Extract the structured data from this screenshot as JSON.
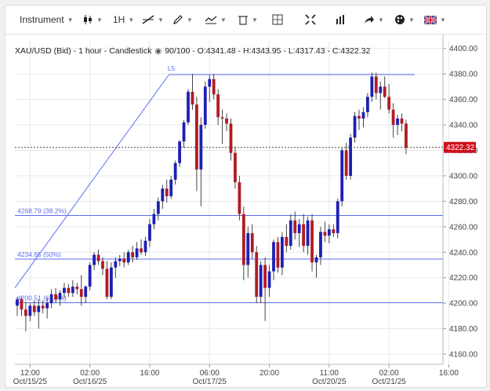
{
  "toolbar": {
    "instrument_label": "Instrument",
    "timeframe_label": "1H",
    "icons": [
      "candlestick-icon",
      "line-tool-icon",
      "pencil-icon",
      "compare-icon",
      "trash-icon",
      "crosshair-icon",
      "fullscreen-icon",
      "volume-bars-icon",
      "share-arrow-icon",
      "palette-icon",
      "flag-uk-icon"
    ]
  },
  "legend": {
    "symbol": "XAU/USD (Bid) - 1 hour - Candlestick",
    "quality": "90/100",
    "ohlc": "- O:4341.48 - H:4343.95 - L:4317.43 - C:4322.32"
  },
  "colors": {
    "up": "#1f1fb4",
    "down": "#b01c24",
    "line": "#5b6ef0",
    "last_price": "#d0101c"
  },
  "chart_data": {
    "type": "candlestick",
    "y_ticks": [
      "4400.00",
      "4380.00",
      "4360.00",
      "4340.00",
      "4320.00",
      "4300.00",
      "4280.00",
      "4260.00",
      "4240.00",
      "4220.00",
      "4200.00",
      "4180.00",
      "4160.00"
    ],
    "ylim": [
      4152,
      4406
    ],
    "x_ticks": [
      {
        "time": "12:00",
        "date": "Oct/15/25",
        "i": 3
      },
      {
        "time": "02:00",
        "date": "Oct/16/25",
        "i": 17
      },
      {
        "time": "16:00",
        "date": "",
        "i": 31
      },
      {
        "time": "06:00",
        "date": "Oct/17/25",
        "i": 45
      },
      {
        "time": "20:00",
        "date": "",
        "i": 59
      },
      {
        "time": "11:00",
        "date": "Oct/20/25",
        "i": 73
      },
      {
        "time": "02:00",
        "date": "Oct/21/25",
        "i": 87
      },
      {
        "time": "16:00",
        "date": "",
        "i": 101
      }
    ],
    "last_price": 4322.32,
    "last_price_label": "4322.32",
    "fib_levels": [
      {
        "label": "4268.79 (38.2%)",
        "value": 4268.79
      },
      {
        "label": "4234.65 (50%)",
        "value": 4234.65
      },
      {
        "label": "4200.51 (61.8%)",
        "value": 4200.51
      }
    ],
    "top_line": {
      "label": "L5",
      "value": 4379.5
    },
    "candles": [
      {
        "o": 4198,
        "h": 4205,
        "l": 4190,
        "c": 4203
      },
      {
        "o": 4203,
        "h": 4205,
        "l": 4190,
        "c": 4195
      },
      {
        "o": 4195,
        "h": 4201,
        "l": 4178,
        "c": 4190
      },
      {
        "o": 4190,
        "h": 4200,
        "l": 4186,
        "c": 4198
      },
      {
        "o": 4198,
        "h": 4202,
        "l": 4190,
        "c": 4193
      },
      {
        "o": 4193,
        "h": 4203,
        "l": 4180,
        "c": 4198
      },
      {
        "o": 4198,
        "h": 4202,
        "l": 4192,
        "c": 4196
      },
      {
        "o": 4196,
        "h": 4204,
        "l": 4188,
        "c": 4200
      },
      {
        "o": 4200,
        "h": 4211,
        "l": 4196,
        "c": 4207
      },
      {
        "o": 4207,
        "h": 4212,
        "l": 4200,
        "c": 4203
      },
      {
        "o": 4203,
        "h": 4210,
        "l": 4198,
        "c": 4208
      },
      {
        "o": 4208,
        "h": 4216,
        "l": 4204,
        "c": 4212
      },
      {
        "o": 4212,
        "h": 4215,
        "l": 4205,
        "c": 4208
      },
      {
        "o": 4208,
        "h": 4218,
        "l": 4205,
        "c": 4213
      },
      {
        "o": 4213,
        "h": 4216,
        "l": 4207,
        "c": 4211
      },
      {
        "o": 4211,
        "h": 4222,
        "l": 4198,
        "c": 4205
      },
      {
        "o": 4205,
        "h": 4214,
        "l": 4200,
        "c": 4213
      },
      {
        "o": 4213,
        "h": 4232,
        "l": 4210,
        "c": 4230
      },
      {
        "o": 4230,
        "h": 4240,
        "l": 4226,
        "c": 4238
      },
      {
        "o": 4238,
        "h": 4242,
        "l": 4230,
        "c": 4233
      },
      {
        "o": 4233,
        "h": 4236,
        "l": 4222,
        "c": 4227
      },
      {
        "o": 4227,
        "h": 4233,
        "l": 4203,
        "c": 4205
      },
      {
        "o": 4205,
        "h": 4232,
        "l": 4203,
        "c": 4228
      },
      {
        "o": 4228,
        "h": 4236,
        "l": 4220,
        "c": 4233
      },
      {
        "o": 4233,
        "h": 4238,
        "l": 4229,
        "c": 4235
      },
      {
        "o": 4235,
        "h": 4240,
        "l": 4228,
        "c": 4232
      },
      {
        "o": 4232,
        "h": 4242,
        "l": 4230,
        "c": 4240
      },
      {
        "o": 4240,
        "h": 4245,
        "l": 4232,
        "c": 4236
      },
      {
        "o": 4236,
        "h": 4248,
        "l": 4234,
        "c": 4243
      },
      {
        "o": 4243,
        "h": 4250,
        "l": 4238,
        "c": 4240
      },
      {
        "o": 4240,
        "h": 4252,
        "l": 4237,
        "c": 4249
      },
      {
        "o": 4249,
        "h": 4266,
        "l": 4244,
        "c": 4262
      },
      {
        "o": 4262,
        "h": 4274,
        "l": 4258,
        "c": 4270
      },
      {
        "o": 4270,
        "h": 4283,
        "l": 4265,
        "c": 4280
      },
      {
        "o": 4280,
        "h": 4293,
        "l": 4274,
        "c": 4290
      },
      {
        "o": 4290,
        "h": 4297,
        "l": 4279,
        "c": 4284
      },
      {
        "o": 4284,
        "h": 4300,
        "l": 4282,
        "c": 4297
      },
      {
        "o": 4297,
        "h": 4312,
        "l": 4293,
        "c": 4310
      },
      {
        "o": 4310,
        "h": 4328,
        "l": 4307,
        "c": 4327
      },
      {
        "o": 4327,
        "h": 4344,
        "l": 4322,
        "c": 4342
      },
      {
        "o": 4342,
        "h": 4368,
        "l": 4340,
        "c": 4366
      },
      {
        "o": 4366,
        "h": 4380,
        "l": 4352,
        "c": 4356
      },
      {
        "o": 4356,
        "h": 4362,
        "l": 4288,
        "c": 4305
      },
      {
        "o": 4305,
        "h": 4346,
        "l": 4276,
        "c": 4340
      },
      {
        "o": 4340,
        "h": 4374,
        "l": 4337,
        "c": 4370
      },
      {
        "o": 4370,
        "h": 4379,
        "l": 4358,
        "c": 4376
      },
      {
        "o": 4376,
        "h": 4380,
        "l": 4360,
        "c": 4364
      },
      {
        "o": 4364,
        "h": 4368,
        "l": 4340,
        "c": 4346
      },
      {
        "o": 4346,
        "h": 4352,
        "l": 4325,
        "c": 4345
      },
      {
        "o": 4345,
        "h": 4349,
        "l": 4335,
        "c": 4341
      },
      {
        "o": 4341,
        "h": 4345,
        "l": 4312,
        "c": 4318
      },
      {
        "o": 4318,
        "h": 4323,
        "l": 4290,
        "c": 4295
      },
      {
        "o": 4295,
        "h": 4300,
        "l": 4265,
        "c": 4270
      },
      {
        "o": 4270,
        "h": 4276,
        "l": 4218,
        "c": 4230
      },
      {
        "o": 4230,
        "h": 4260,
        "l": 4220,
        "c": 4255
      },
      {
        "o": 4255,
        "h": 4262,
        "l": 4235,
        "c": 4240
      },
      {
        "o": 4240,
        "h": 4245,
        "l": 4200,
        "c": 4205
      },
      {
        "o": 4205,
        "h": 4233,
        "l": 4200,
        "c": 4230
      },
      {
        "o": 4230,
        "h": 4236,
        "l": 4186,
        "c": 4212
      },
      {
        "o": 4212,
        "h": 4230,
        "l": 4205,
        "c": 4225
      },
      {
        "o": 4225,
        "h": 4250,
        "l": 4218,
        "c": 4248
      },
      {
        "o": 4248,
        "h": 4252,
        "l": 4224,
        "c": 4228
      },
      {
        "o": 4228,
        "h": 4256,
        "l": 4222,
        "c": 4252
      },
      {
        "o": 4252,
        "h": 4262,
        "l": 4240,
        "c": 4245
      },
      {
        "o": 4245,
        "h": 4270,
        "l": 4242,
        "c": 4265
      },
      {
        "o": 4265,
        "h": 4272,
        "l": 4250,
        "c": 4255
      },
      {
        "o": 4255,
        "h": 4266,
        "l": 4244,
        "c": 4262
      },
      {
        "o": 4262,
        "h": 4270,
        "l": 4240,
        "c": 4245
      },
      {
        "o": 4245,
        "h": 4268,
        "l": 4238,
        "c": 4265
      },
      {
        "o": 4265,
        "h": 4270,
        "l": 4225,
        "c": 4232
      },
      {
        "o": 4232,
        "h": 4238,
        "l": 4220,
        "c": 4236
      },
      {
        "o": 4236,
        "h": 4260,
        "l": 4230,
        "c": 4256
      },
      {
        "o": 4256,
        "h": 4264,
        "l": 4248,
        "c": 4253
      },
      {
        "o": 4253,
        "h": 4262,
        "l": 4247,
        "c": 4258
      },
      {
        "o": 4258,
        "h": 4262,
        "l": 4252,
        "c": 4255
      },
      {
        "o": 4255,
        "h": 4282,
        "l": 4251,
        "c": 4280
      },
      {
        "o": 4280,
        "h": 4322,
        "l": 4276,
        "c": 4320
      },
      {
        "o": 4320,
        "h": 4326,
        "l": 4297,
        "c": 4300
      },
      {
        "o": 4300,
        "h": 4333,
        "l": 4297,
        "c": 4330
      },
      {
        "o": 4330,
        "h": 4350,
        "l": 4326,
        "c": 4347
      },
      {
        "o": 4347,
        "h": 4352,
        "l": 4336,
        "c": 4345
      },
      {
        "o": 4345,
        "h": 4354,
        "l": 4338,
        "c": 4350
      },
      {
        "o": 4350,
        "h": 4365,
        "l": 4346,
        "c": 4362
      },
      {
        "o": 4362,
        "h": 4381,
        "l": 4358,
        "c": 4378
      },
      {
        "o": 4378,
        "h": 4381,
        "l": 4360,
        "c": 4365
      },
      {
        "o": 4365,
        "h": 4374,
        "l": 4352,
        "c": 4370
      },
      {
        "o": 4370,
        "h": 4378,
        "l": 4361,
        "c": 4362
      },
      {
        "o": 4362,
        "h": 4372,
        "l": 4349,
        "c": 4352
      },
      {
        "o": 4352,
        "h": 4357,
        "l": 4330,
        "c": 4340
      },
      {
        "o": 4340,
        "h": 4348,
        "l": 4332,
        "c": 4345
      },
      {
        "o": 4345,
        "h": 4349,
        "l": 4335,
        "c": 4341
      },
      {
        "o": 4341,
        "h": 4344,
        "l": 4317,
        "c": 4322
      }
    ]
  }
}
